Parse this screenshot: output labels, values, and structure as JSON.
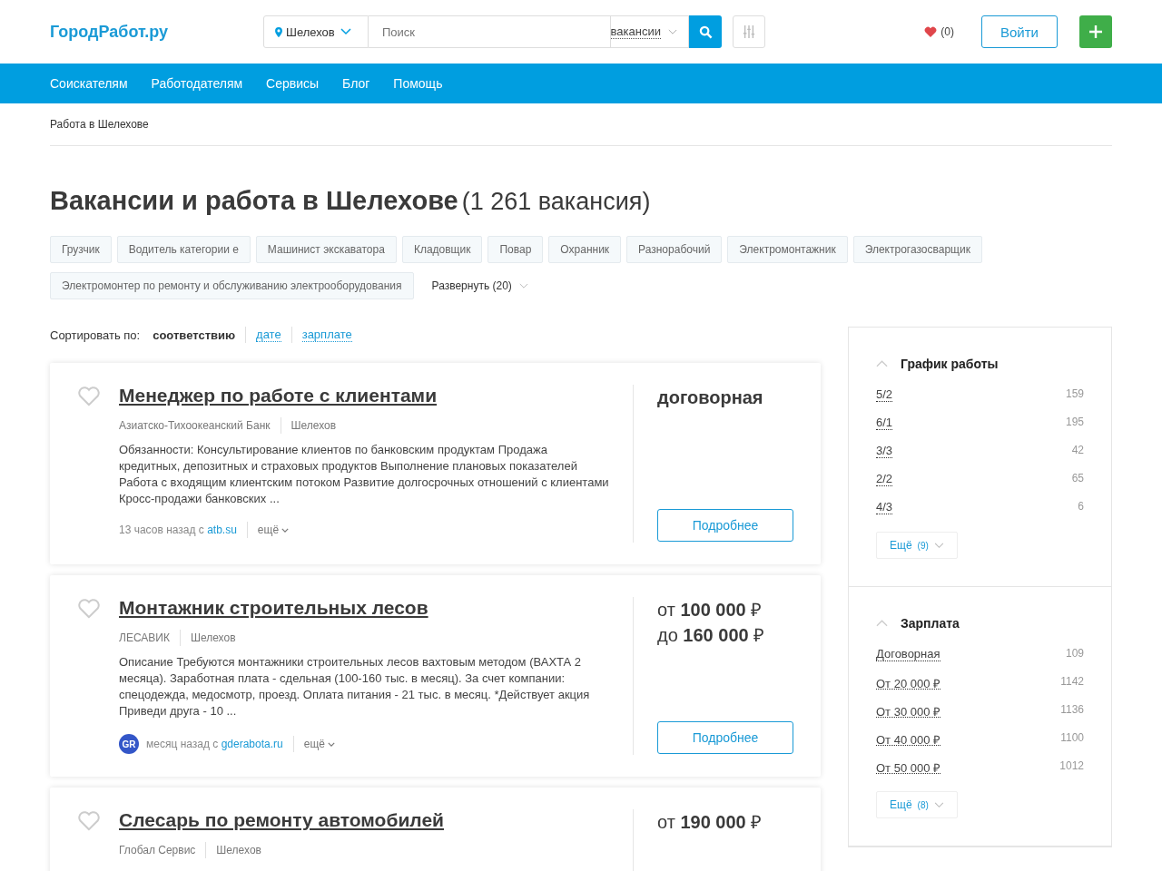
{
  "header": {
    "logo": "ГородРабот.ру",
    "location": "Шелехов",
    "search": {
      "placeholder": "Поиск"
    },
    "search_type": "вакансии",
    "favorites": "(0)",
    "login": "Войти"
  },
  "nav": [
    "Соискателям",
    "Работодателям",
    "Сервисы",
    "Блог",
    "Помощь"
  ],
  "breadcrumb": "Работа в Шелехове",
  "title": "Вакансии и работа в Шелехове",
  "count": "(1 261 вакансия)",
  "tags": [
    "Грузчик",
    "Водитель категории е",
    "Машинист экскаватора",
    "Кладовщик",
    "Повар",
    "Охранник",
    "Разнорабочий",
    "Электромонтажник",
    "Электрогазосварщик",
    "Электромонтер по ремонту и обслуживанию электрооборудования"
  ],
  "expand": "Развернуть (20)",
  "sort": {
    "label": "Сортировать по:",
    "options": [
      {
        "label": "соответствию",
        "selected": true
      },
      {
        "label": "дате",
        "selected": false
      },
      {
        "label": "зарплате",
        "selected": false
      }
    ]
  },
  "vacancies": [
    {
      "title": "Менеджер по работе с клиентами",
      "company": "Азиатско-Тихоокеанский Банк",
      "city": "Шелехов",
      "description": "Обязанности: Консультирование клиентов по банковским продуктам Продажа кредитных, депозитных и страховых продуктов Выполнение плановых показателей Работа с входящим клиентским потоком Развитие долгосрочных отношений с клиентами Кросс-продажи банковских ...",
      "time": "13 часов назад с",
      "source": "atb.su",
      "more": "ещё",
      "salary": [
        "**договорная**"
      ],
      "button": "Подробнее"
    },
    {
      "title": "Монтажник строительных лесов",
      "company": "ЛЕСАВИК",
      "city": "Шелехов",
      "description": "Описание Требуются монтажники строительных лесов вахтовым методом (ВАХТА 2 месяца). Заработная плата - сдельная (100-160 тыс. в месяц). За счет компании: спецодежда, медосмотр, проезд. Оплата питания - 21 тыс. в месяц. *Действует акция Приведи друга - 10 ...",
      "avatar": "GR",
      "time": "месяц назад с",
      "source": "gderabota.ru",
      "more": "ещё",
      "salary": [
        "от **100 000** ₽",
        "до **160 000** ₽"
      ],
      "button": "Подробнее"
    },
    {
      "title": "Слесарь по ремонту автомобилей",
      "company": "Глобал Сервис",
      "city": "Шелехов",
      "salary": [
        "от **190 000** ₽"
      ]
    }
  ],
  "filters": [
    {
      "title": "График работы",
      "expanded": true,
      "items": [
        {
          "label": "5/2",
          "count": "159"
        },
        {
          "label": "6/1",
          "count": "195"
        },
        {
          "label": "3/3",
          "count": "42"
        },
        {
          "label": "2/2",
          "count": "65"
        },
        {
          "label": "4/3",
          "count": "6"
        }
      ],
      "more": "Ещё",
      "more_count": "(9)"
    },
    {
      "title": "Зарплата",
      "expanded": true,
      "items": [
        {
          "label": "Договорная",
          "count": "109"
        },
        {
          "label": "От 20 000 ₽",
          "count": "1142"
        },
        {
          "label": "От 30 000 ₽",
          "count": "1136"
        },
        {
          "label": "От 40 000 ₽",
          "count": "1100"
        },
        {
          "label": "От 50 000 ₽",
          "count": "1012"
        }
      ],
      "more": "Ещё",
      "more_count": "(8)"
    }
  ]
}
